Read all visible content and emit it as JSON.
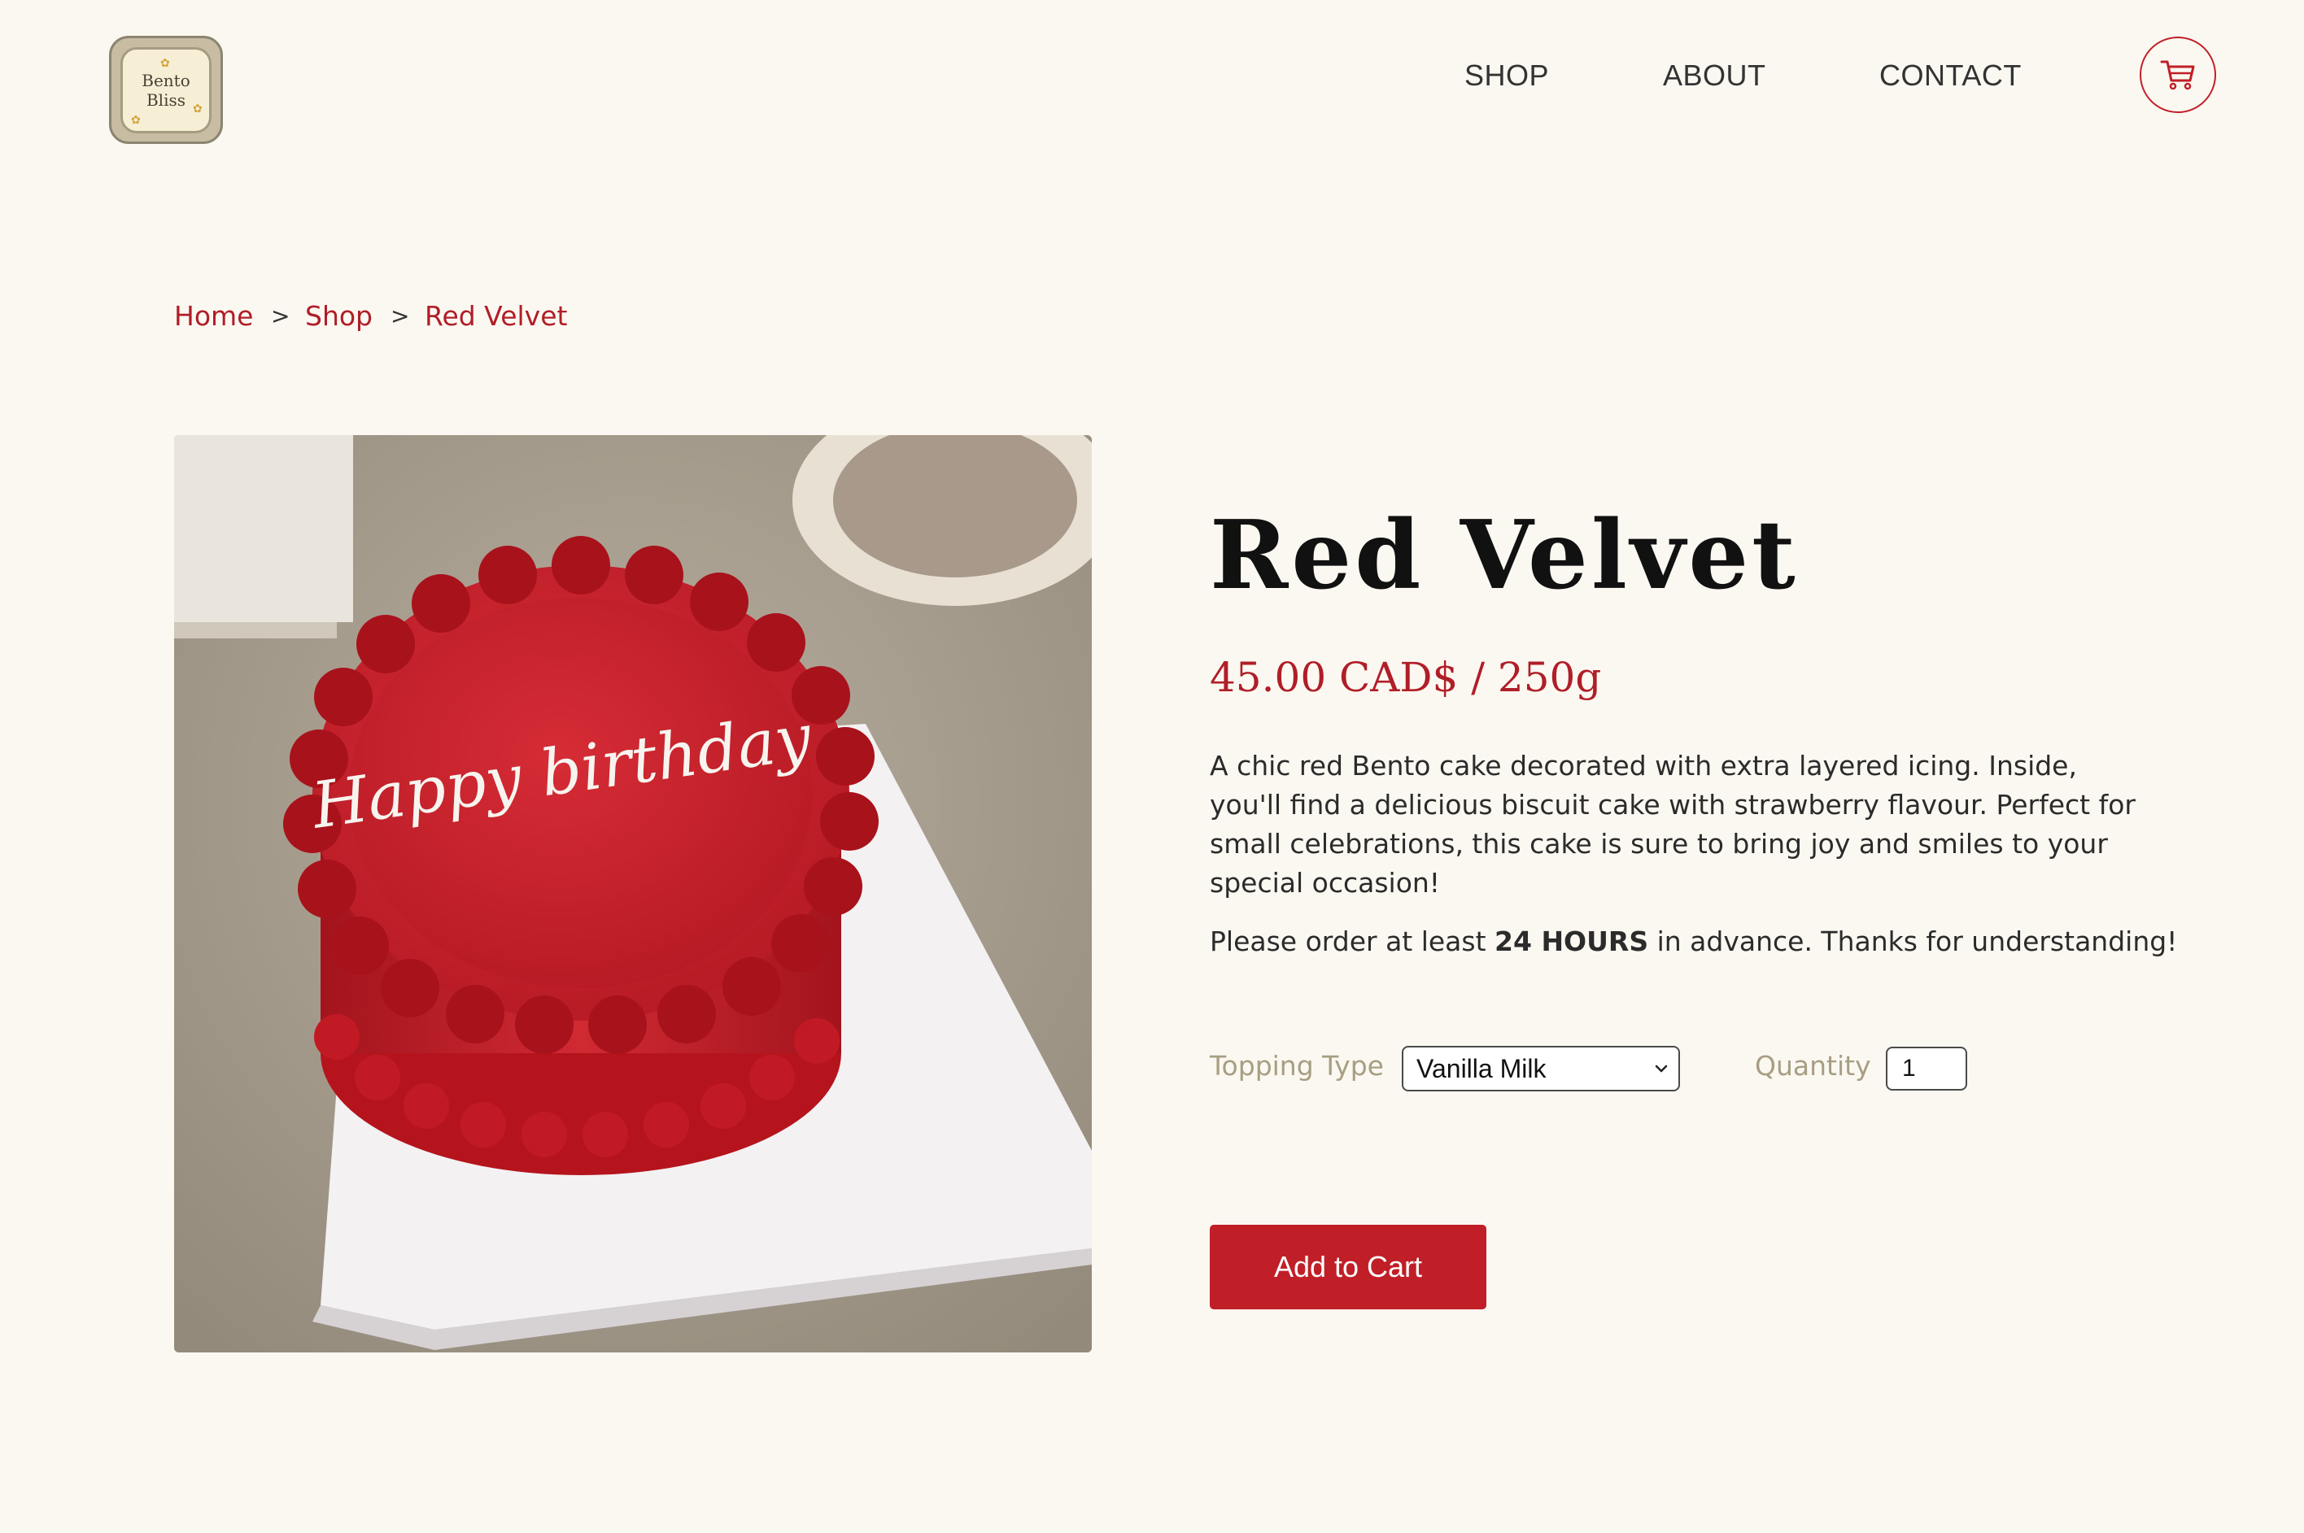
{
  "brand": {
    "logo_line1": "Bento",
    "logo_line2": "Bliss"
  },
  "nav": {
    "items": [
      {
        "label": "SHOP"
      },
      {
        "label": "ABOUT"
      },
      {
        "label": "CONTACT"
      }
    ],
    "cart_icon": "cart-icon"
  },
  "breadcrumb": {
    "items": [
      "Home",
      "Shop",
      "Red Velvet"
    ],
    "separator": ">"
  },
  "product": {
    "image_icon": "cake-photo",
    "cake_writing": "Happy birthday",
    "title": "Red Velvet",
    "price": "45.00 CAD$ / 250g",
    "description": "A chic red Bento cake decorated with extra layered icing. Inside, you'll find a delicious biscuit cake with strawberry flavour. Perfect for small celebrations, this cake is sure to bring joy and smiles to your special occasion!",
    "note_before": "Please order at least ",
    "note_bold": "24 HOURS",
    "note_after": " in advance. Thanks for understanding!",
    "topping_label": "Topping Type",
    "topping_selected": "Vanilla Milk",
    "quantity_label": "Quantity",
    "quantity_value": "1",
    "add_to_cart": "Add to Cart"
  },
  "colors": {
    "background": "#fbf8f1",
    "accent": "#c01f28",
    "label": "#a79e83"
  }
}
